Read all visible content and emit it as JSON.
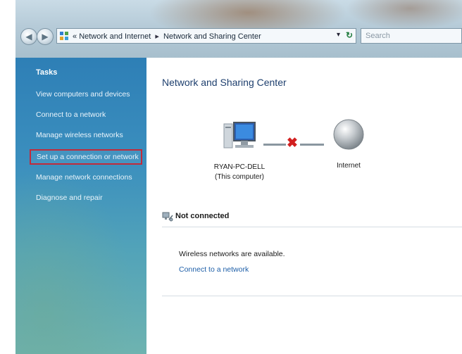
{
  "address_bar": {
    "prefix": "«",
    "crumbs": [
      "Network and Internet",
      "Network and Sharing Center"
    ],
    "separator": "▸",
    "dropdown": "▾",
    "refresh": "↻"
  },
  "search": {
    "placeholder": "Search"
  },
  "sidebar": {
    "title": "Tasks",
    "items": [
      {
        "label": "View computers and devices"
      },
      {
        "label": "Connect to a network"
      },
      {
        "label": "Manage wireless networks"
      },
      {
        "label": "Set up a connection or network",
        "selected": true
      },
      {
        "label": "Manage network connections"
      },
      {
        "label": "Diagnose and repair"
      }
    ]
  },
  "main": {
    "title": "Network and Sharing Center",
    "network_map": {
      "computer_name": "RYAN-PC-DELL",
      "computer_subtitle": "(This computer)",
      "internet_label": "Internet",
      "status_mark": "✖"
    },
    "status": "Not connected",
    "message": "Wireless networks are available.",
    "link": "Connect to a network"
  },
  "colors": {
    "sidebar_top": "#2e7fb6",
    "selection_border": "#c22a3a",
    "title_color": "#1e3f6e",
    "link_color": "#1e5fa8",
    "error_x": "#d21f1f"
  },
  "icons": {
    "back": "back-arrow-icon",
    "forward": "forward-arrow-icon",
    "address": "network-folder-icon",
    "computer": "computer-icon",
    "globe": "internet-globe-icon",
    "status": "network-status-icon"
  }
}
